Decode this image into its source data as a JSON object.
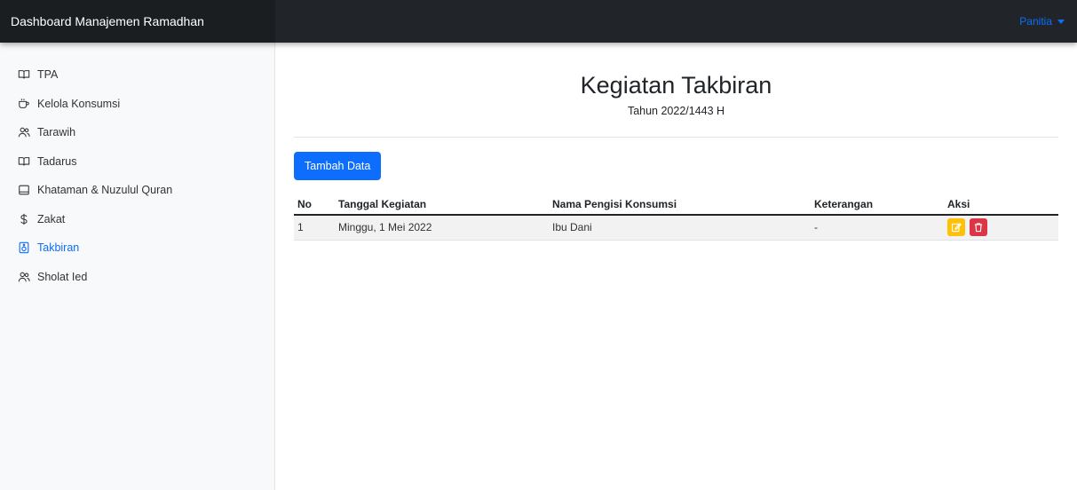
{
  "header": {
    "brand": "Dashboard Manajemen Ramadhan",
    "user_menu": "Panitia"
  },
  "sidebar": {
    "items": [
      {
        "label": "TPA",
        "icon": "book-icon"
      },
      {
        "label": "Kelola Konsumsi",
        "icon": "cup-icon"
      },
      {
        "label": "Tarawih",
        "icon": "users-icon"
      },
      {
        "label": "Tadarus",
        "icon": "book-icon"
      },
      {
        "label": "Khataman & Nuzulul Quran",
        "icon": "square-icon"
      },
      {
        "label": "Zakat",
        "icon": "dollar-icon"
      },
      {
        "label": "Takbiran",
        "icon": "speaker-icon",
        "active": true
      },
      {
        "label": "Sholat Ied",
        "icon": "users-icon"
      }
    ]
  },
  "main": {
    "title": "Kegiatan Takbiran",
    "subtitle": "Tahun 2022/1443 H",
    "add_button": "Tambah Data",
    "table": {
      "headers": [
        "No",
        "Tanggal Kegiatan",
        "Nama Pengisi Konsumsi",
        "Keterangan",
        "Aksi"
      ],
      "rows": [
        {
          "no": "1",
          "tanggal": "Minggu, 1 Mei 2022",
          "nama": "Ibu Dani",
          "keterangan": "-"
        }
      ]
    }
  },
  "colors": {
    "topbar": "#212529",
    "accent": "#0d6efd",
    "edit": "#ffc107",
    "delete": "#dc3545"
  }
}
